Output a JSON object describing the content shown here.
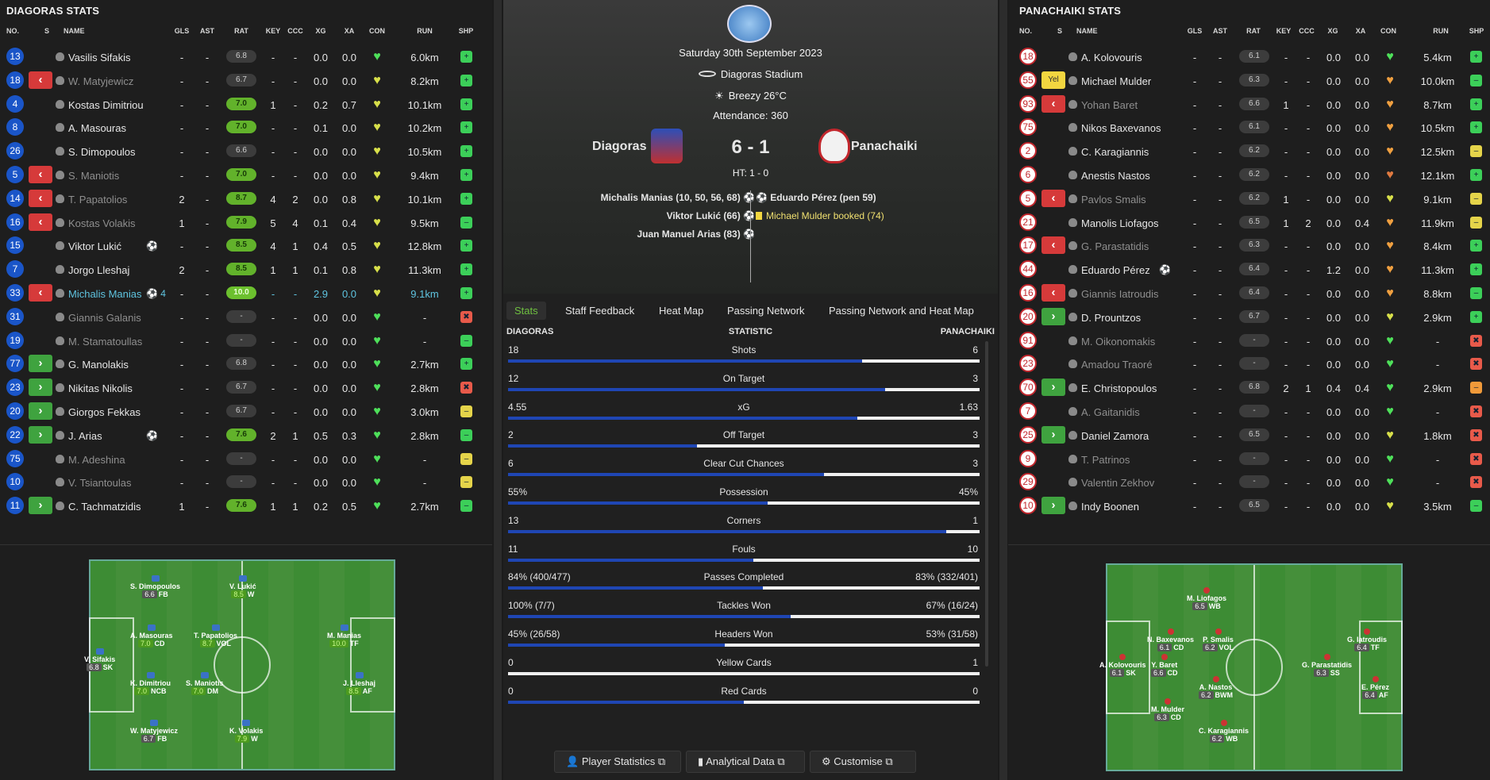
{
  "left": {
    "title": "DIAGORAS STATS",
    "headers": {
      "no": "NO.",
      "s": "S",
      "name": "NAME",
      "gls": "GLS",
      "ast": "AST",
      "rat": "RAT",
      "key": "KEY",
      "ccc": "CCC",
      "xg": "XG",
      "xa": "XA",
      "con": "CON",
      "run": "RUN",
      "shp": "SHP"
    },
    "players": [
      {
        "no": "13",
        "sub": "",
        "name": "Vasilis Sifakis",
        "style": "",
        "gls": "-",
        "ast": "-",
        "rat": "6.8",
        "rc": "",
        "key": "-",
        "ccc": "-",
        "xg": "0.0",
        "xa": "0.0",
        "con": "#4ee05a",
        "run": "6.0km",
        "shp": "g"
      },
      {
        "no": "18",
        "sub": "off",
        "name": "W. Matyjewicz",
        "style": "dim",
        "gls": "-",
        "ast": "-",
        "rat": "6.7",
        "rc": "",
        "key": "-",
        "ccc": "-",
        "xg": "0.0",
        "xa": "0.0",
        "con": "#d8e04a",
        "run": "8.2km",
        "shp": "g"
      },
      {
        "no": "4",
        "sub": "",
        "name": "Kostas Dimitriou",
        "style": "",
        "gls": "-",
        "ast": "-",
        "rat": "7.0",
        "rc": "g",
        "key": "1",
        "ccc": "-",
        "xg": "0.2",
        "xa": "0.7",
        "con": "#d8e04a",
        "run": "10.1km",
        "shp": "g"
      },
      {
        "no": "8",
        "sub": "",
        "name": "A. Masouras",
        "style": "",
        "gls": "-",
        "ast": "-",
        "rat": "7.0",
        "rc": "g",
        "key": "-",
        "ccc": "-",
        "xg": "0.1",
        "xa": "0.0",
        "con": "#d8e04a",
        "run": "10.2km",
        "shp": "g"
      },
      {
        "no": "26",
        "sub": "",
        "name": "S. Dimopoulos",
        "style": "",
        "gls": "-",
        "ast": "-",
        "rat": "6.6",
        "rc": "",
        "key": "-",
        "ccc": "-",
        "xg": "0.0",
        "xa": "0.0",
        "con": "#d8e04a",
        "run": "10.5km",
        "shp": "g"
      },
      {
        "no": "5",
        "sub": "off",
        "name": "S. Maniotis",
        "style": "dim",
        "gls": "-",
        "ast": "-",
        "rat": "7.0",
        "rc": "g",
        "key": "-",
        "ccc": "-",
        "xg": "0.0",
        "xa": "0.0",
        "con": "#d8e04a",
        "run": "9.4km",
        "shp": "g"
      },
      {
        "no": "14",
        "sub": "off",
        "name": "T. Papatolios",
        "style": "dim",
        "gls": "2",
        "ast": "-",
        "rat": "8.7",
        "rc": "g",
        "key": "4",
        "ccc": "2",
        "xg": "0.0",
        "xa": "0.8",
        "con": "#d8e04a",
        "run": "10.1km",
        "shp": "g"
      },
      {
        "no": "16",
        "sub": "off",
        "name": "Kostas Volakis",
        "style": "dim",
        "gls": "1",
        "ast": "-",
        "rat": "7.9",
        "rc": "g",
        "key": "5",
        "ccc": "4",
        "xg": "0.1",
        "xa": "0.4",
        "con": "#d8e04a",
        "run": "9.5km",
        "shp": "g2"
      },
      {
        "no": "15",
        "sub": "",
        "name": "Viktor Lukić",
        "style": "",
        "gls": "-",
        "ast": "-",
        "rat": "8.5",
        "rc": "g",
        "key": "4",
        "ccc": "1",
        "xg": "0.4",
        "xa": "0.5",
        "con": "#d8e04a",
        "run": "12.8km",
        "shp": "g",
        "ball": "1"
      },
      {
        "no": "7",
        "sub": "",
        "name": "Jorgo Lleshaj",
        "style": "",
        "gls": "2",
        "ast": "-",
        "rat": "8.5",
        "rc": "g",
        "key": "1",
        "ccc": "1",
        "xg": "0.1",
        "xa": "0.8",
        "con": "#d8e04a",
        "run": "11.3km",
        "shp": "g"
      },
      {
        "no": "33",
        "sub": "off",
        "name": "Michalis Manias",
        "style": "hl",
        "gls": "-",
        "ast": "-",
        "rat": "10.0",
        "rc": "hi",
        "key": "-",
        "ccc": "-",
        "xg": "2.9",
        "xa": "0.0",
        "con": "#d8e04a",
        "run": "9.1km",
        "shp": "g",
        "ball": "4"
      },
      {
        "no": "31",
        "sub": "",
        "name": "Giannis Galanis",
        "style": "dim",
        "gls": "-",
        "ast": "-",
        "rat": "-",
        "rc": "",
        "key": "-",
        "ccc": "-",
        "xg": "0.0",
        "xa": "0.0",
        "con": "#4ee05a",
        "run": "-",
        "shp": "r"
      },
      {
        "no": "19",
        "sub": "",
        "name": "M. Stamatoullas",
        "style": "dim",
        "gls": "-",
        "ast": "-",
        "rat": "-",
        "rc": "",
        "key": "-",
        "ccc": "-",
        "xg": "0.0",
        "xa": "0.0",
        "con": "#4ee05a",
        "run": "-",
        "shp": "g2"
      },
      {
        "no": "77",
        "sub": "on",
        "name": "G. Manolakis",
        "style": "",
        "gls": "-",
        "ast": "-",
        "rat": "6.8",
        "rc": "",
        "key": "-",
        "ccc": "-",
        "xg": "0.0",
        "xa": "0.0",
        "con": "#4ee05a",
        "run": "2.7km",
        "shp": "g"
      },
      {
        "no": "23",
        "sub": "on",
        "name": "Nikitas Nikolis",
        "style": "",
        "gls": "-",
        "ast": "-",
        "rat": "6.7",
        "rc": "",
        "key": "-",
        "ccc": "-",
        "xg": "0.0",
        "xa": "0.0",
        "con": "#4ee05a",
        "run": "2.8km",
        "shp": "r"
      },
      {
        "no": "20",
        "sub": "on",
        "name": "Giorgos Fekkas",
        "style": "",
        "gls": "-",
        "ast": "-",
        "rat": "6.7",
        "rc": "",
        "key": "-",
        "ccc": "-",
        "xg": "0.0",
        "xa": "0.0",
        "con": "#4ee05a",
        "run": "3.0km",
        "shp": "y"
      },
      {
        "no": "22",
        "sub": "on",
        "name": "J. Arias",
        "style": "",
        "gls": "-",
        "ast": "-",
        "rat": "7.6",
        "rc": "g",
        "key": "2",
        "ccc": "1",
        "xg": "0.5",
        "xa": "0.3",
        "con": "#4ee05a",
        "run": "2.8km",
        "shp": "g2",
        "ball": "1"
      },
      {
        "no": "75",
        "sub": "",
        "name": "M. Adeshina",
        "style": "dim",
        "gls": "-",
        "ast": "-",
        "rat": "-",
        "rc": "",
        "key": "-",
        "ccc": "-",
        "xg": "0.0",
        "xa": "0.0",
        "con": "#4ee05a",
        "run": "-",
        "shp": "y"
      },
      {
        "no": "10",
        "sub": "",
        "name": "V. Tsiantoulas",
        "style": "dim",
        "gls": "-",
        "ast": "-",
        "rat": "-",
        "rc": "",
        "key": "-",
        "ccc": "-",
        "xg": "0.0",
        "xa": "0.0",
        "con": "#4ee05a",
        "run": "-",
        "shp": "y"
      },
      {
        "no": "11",
        "sub": "on",
        "name": "C. Tachmatzidis",
        "style": "",
        "gls": "1",
        "ast": "-",
        "rat": "7.6",
        "rc": "g",
        "key": "1",
        "ccc": "1",
        "xg": "0.2",
        "xa": "0.5",
        "con": "#4ee05a",
        "run": "2.7km",
        "shp": "g2"
      }
    ],
    "pitch": [
      {
        "num": "26",
        "name": "S. Dimopoulos",
        "rat": "6.6",
        "rg": "",
        "pos": "FB"
      },
      {
        "num": "15",
        "name": "V. Lukić",
        "rat": "8.5",
        "rg": "g",
        "pos": "W"
      },
      {
        "num": "8",
        "name": "A. Masouras",
        "rat": "7.0",
        "rg": "g",
        "pos": "CD"
      },
      {
        "num": "14",
        "name": "T. Papatolios",
        "rat": "8.7",
        "rg": "g",
        "pos": "VOL"
      },
      {
        "num": "33",
        "name": "M. Manias",
        "rat": "10.0",
        "rg": "g",
        "pos": "TF"
      },
      {
        "num": "13",
        "name": "V. Sifakis",
        "rat": "6.8",
        "rg": "",
        "pos": "SK"
      },
      {
        "num": "4",
        "name": "K. Dimitriou",
        "rat": "7.0",
        "rg": "g",
        "pos": "NCB"
      },
      {
        "num": "5",
        "name": "S. Maniotis",
        "rat": "7.0",
        "rg": "g",
        "pos": "DM"
      },
      {
        "num": "7",
        "name": "J. Lleshaj",
        "rat": "8.5",
        "rg": "g",
        "pos": "AF"
      },
      {
        "num": "18",
        "name": "W. Matyjewicz",
        "rat": "6.7",
        "rg": "",
        "pos": "FB"
      },
      {
        "num": "16",
        "name": "K. Volakis",
        "rat": "7.9",
        "rg": "g",
        "pos": "W"
      }
    ]
  },
  "right": {
    "title": "PANACHAIKI STATS",
    "players": [
      {
        "no": "18",
        "sub": "",
        "name": "A. Kolovouris",
        "style": "",
        "gls": "-",
        "ast": "-",
        "rat": "6.1",
        "rc": "",
        "key": "-",
        "ccc": "-",
        "xg": "0.0",
        "xa": "0.0",
        "con": "#4ee05a",
        "run": "5.4km",
        "shp": "g"
      },
      {
        "no": "55",
        "sub": "yel",
        "name": "Michael Mulder",
        "style": "",
        "gls": "-",
        "ast": "-",
        "rat": "6.3",
        "rc": "",
        "key": "-",
        "ccc": "-",
        "xg": "0.0",
        "xa": "0.0",
        "con": "#f0a040",
        "run": "10.0km",
        "shp": "g2"
      },
      {
        "no": "93",
        "sub": "off",
        "name": "Yohan Baret",
        "style": "dim",
        "gls": "-",
        "ast": "-",
        "rat": "6.6",
        "rc": "",
        "key": "1",
        "ccc": "-",
        "xg": "0.0",
        "xa": "0.0",
        "con": "#f0a040",
        "run": "8.7km",
        "shp": "g"
      },
      {
        "no": "75",
        "sub": "",
        "name": "Nikos Baxevanos",
        "style": "",
        "gls": "-",
        "ast": "-",
        "rat": "6.1",
        "rc": "",
        "key": "-",
        "ccc": "-",
        "xg": "0.0",
        "xa": "0.0",
        "con": "#f0a040",
        "run": "10.5km",
        "shp": "g"
      },
      {
        "no": "2",
        "sub": "",
        "name": "C. Karagiannis",
        "style": "",
        "gls": "-",
        "ast": "-",
        "rat": "6.2",
        "rc": "",
        "key": "-",
        "ccc": "-",
        "xg": "0.0",
        "xa": "0.0",
        "con": "#f0a040",
        "run": "12.5km",
        "shp": "y"
      },
      {
        "no": "6",
        "sub": "",
        "name": "Anestis Nastos",
        "style": "",
        "gls": "-",
        "ast": "-",
        "rat": "6.2",
        "rc": "",
        "key": "-",
        "ccc": "-",
        "xg": "0.0",
        "xa": "0.0",
        "con": "#e07a40",
        "run": "12.1km",
        "shp": "g"
      },
      {
        "no": "5",
        "sub": "off",
        "name": "Pavlos Smalis",
        "style": "dim",
        "gls": "-",
        "ast": "-",
        "rat": "6.2",
        "rc": "",
        "key": "1",
        "ccc": "-",
        "xg": "0.0",
        "xa": "0.0",
        "con": "#d8e04a",
        "run": "9.1km",
        "shp": "y"
      },
      {
        "no": "21",
        "sub": "",
        "name": "Manolis Liofagos",
        "style": "",
        "gls": "-",
        "ast": "-",
        "rat": "6.5",
        "rc": "",
        "key": "1",
        "ccc": "2",
        "xg": "0.0",
        "xa": "0.4",
        "con": "#f0a040",
        "run": "11.9km",
        "shp": "y"
      },
      {
        "no": "17",
        "sub": "off",
        "name": "G. Parastatidis",
        "style": "dim",
        "gls": "-",
        "ast": "-",
        "rat": "6.3",
        "rc": "",
        "key": "-",
        "ccc": "-",
        "xg": "0.0",
        "xa": "0.0",
        "con": "#f0a040",
        "run": "8.4km",
        "shp": "g"
      },
      {
        "no": "44",
        "sub": "",
        "name": "Eduardo Pérez",
        "style": "",
        "gls": "-",
        "ast": "-",
        "rat": "6.4",
        "rc": "",
        "key": "-",
        "ccc": "-",
        "xg": "1.2",
        "xa": "0.0",
        "con": "#f0a040",
        "run": "11.3km",
        "shp": "g",
        "ball": "1"
      },
      {
        "no": "16",
        "sub": "off",
        "name": "Giannis Iatroudis",
        "style": "dim",
        "gls": "-",
        "ast": "-",
        "rat": "6.4",
        "rc": "",
        "key": "-",
        "ccc": "-",
        "xg": "0.0",
        "xa": "0.0",
        "con": "#f0a040",
        "run": "8.8km",
        "shp": "g2"
      },
      {
        "no": "20",
        "sub": "on",
        "name": "D. Prountzos",
        "style": "",
        "gls": "-",
        "ast": "-",
        "rat": "6.7",
        "rc": "",
        "key": "-",
        "ccc": "-",
        "xg": "0.0",
        "xa": "0.0",
        "con": "#d8e04a",
        "run": "2.9km",
        "shp": "g"
      },
      {
        "no": "91",
        "sub": "",
        "name": "M. Oikonomakis",
        "style": "dim",
        "gls": "-",
        "ast": "-",
        "rat": "-",
        "rc": "",
        "key": "-",
        "ccc": "-",
        "xg": "0.0",
        "xa": "0.0",
        "con": "#4ee05a",
        "run": "-",
        "shp": "r"
      },
      {
        "no": "23",
        "sub": "",
        "name": "Amadou Traoré",
        "style": "dim",
        "gls": "-",
        "ast": "-",
        "rat": "-",
        "rc": "",
        "key": "-",
        "ccc": "-",
        "xg": "0.0",
        "xa": "0.0",
        "con": "#4ee05a",
        "run": "-",
        "shp": "r"
      },
      {
        "no": "70",
        "sub": "on",
        "name": "E. Christopoulos",
        "style": "",
        "gls": "-",
        "ast": "-",
        "rat": "6.8",
        "rc": "",
        "key": "2",
        "ccc": "1",
        "xg": "0.4",
        "xa": "0.4",
        "con": "#4ee05a",
        "run": "2.9km",
        "shp": "o"
      },
      {
        "no": "7",
        "sub": "",
        "name": "A. Gaitanidis",
        "style": "dim",
        "gls": "-",
        "ast": "-",
        "rat": "-",
        "rc": "",
        "key": "-",
        "ccc": "-",
        "xg": "0.0",
        "xa": "0.0",
        "con": "#4ee05a",
        "run": "-",
        "shp": "r"
      },
      {
        "no": "25",
        "sub": "on",
        "name": "Daniel Zamora",
        "style": "",
        "gls": "-",
        "ast": "-",
        "rat": "6.5",
        "rc": "",
        "key": "-",
        "ccc": "-",
        "xg": "0.0",
        "xa": "0.0",
        "con": "#d8e04a",
        "run": "1.8km",
        "shp": "r"
      },
      {
        "no": "9",
        "sub": "",
        "name": "T. Patrinos",
        "style": "dim",
        "gls": "-",
        "ast": "-",
        "rat": "-",
        "rc": "",
        "key": "-",
        "ccc": "-",
        "xg": "0.0",
        "xa": "0.0",
        "con": "#4ee05a",
        "run": "-",
        "shp": "r"
      },
      {
        "no": "29",
        "sub": "",
        "name": "Valentin Zekhov",
        "style": "dim",
        "gls": "-",
        "ast": "-",
        "rat": "-",
        "rc": "",
        "key": "-",
        "ccc": "-",
        "xg": "0.0",
        "xa": "0.0",
        "con": "#4ee05a",
        "run": "-",
        "shp": "r"
      },
      {
        "no": "10",
        "sub": "on",
        "name": "Indy Boonen",
        "style": "",
        "gls": "-",
        "ast": "-",
        "rat": "6.5",
        "rc": "",
        "key": "-",
        "ccc": "-",
        "xg": "0.0",
        "xa": "0.0",
        "con": "#d8e04a",
        "run": "3.5km",
        "shp": "g2"
      }
    ],
    "pitch": [
      {
        "num": "21",
        "name": "M. Liofagos",
        "rat": "6.5",
        "pos": "WB"
      },
      {
        "num": "75",
        "name": "N. Baxevanos",
        "rat": "6.1",
        "pos": "CD"
      },
      {
        "num": "5",
        "name": "P. Smalis",
        "rat": "6.2",
        "pos": "VOL"
      },
      {
        "num": "16",
        "name": "G. Iatroudis",
        "rat": "6.4",
        "pos": "TF"
      },
      {
        "num": "18",
        "name": "A. Kolovouris",
        "rat": "6.1",
        "pos": "SK"
      },
      {
        "num": "93",
        "name": "Y. Baret",
        "rat": "6.6",
        "pos": "CD"
      },
      {
        "num": "17",
        "name": "G. Parastatidis",
        "rat": "6.3",
        "pos": "SS"
      },
      {
        "num": "6",
        "name": "A. Nastos",
        "rat": "6.2",
        "pos": "BWM"
      },
      {
        "num": "44",
        "name": "E. Pérez",
        "rat": "6.4",
        "pos": "AF"
      },
      {
        "num": "55",
        "name": "M. Mulder",
        "rat": "6.3",
        "pos": "CD"
      },
      {
        "num": "2",
        "name": "C. Karagiannis",
        "rat": "6.2",
        "pos": "WB"
      }
    ]
  },
  "match": {
    "date": "Saturday 30th September 2023",
    "stadium": "Diagoras Stadium",
    "weather": "Breezy 26°C",
    "attendance": "Attendance: 360",
    "home": "Diagoras",
    "away": "Panachaiki",
    "score": "6 - 1",
    "ht": "HT: 1 - 0",
    "home_events": [
      "Michalis Manias (10, 50, 56, 68)",
      "Viktor Lukić (66)",
      "Juan Manuel Arias (83)"
    ],
    "away_goal": "Eduardo Pérez (pen 59)",
    "away_booking": "Michael Mulder booked (74)"
  },
  "tabs": [
    "Stats",
    "Staff Feedback",
    "Heat Map",
    "Passing Network",
    "Passing Network and Heat Map"
  ],
  "stats_header": {
    "home": "DIAGORAS",
    "mid": "STATISTIC",
    "away": "PANACHAIKI"
  },
  "stats": [
    {
      "home": "18",
      "label": "Shots",
      "away": "6",
      "frac": 0.75
    },
    {
      "home": "12",
      "label": "On Target",
      "away": "3",
      "frac": 0.8
    },
    {
      "home": "4.55",
      "label": "xG",
      "away": "1.63",
      "frac": 0.74
    },
    {
      "home": "2",
      "label": "Off Target",
      "away": "3",
      "frac": 0.4
    },
    {
      "home": "6",
      "label": "Clear Cut Chances",
      "away": "3",
      "frac": 0.67
    },
    {
      "home": "55%",
      "label": "Possession",
      "away": "45%",
      "frac": 0.55
    },
    {
      "home": "13",
      "label": "Corners",
      "away": "1",
      "frac": 0.93
    },
    {
      "home": "11",
      "label": "Fouls",
      "away": "10",
      "frac": 0.52
    },
    {
      "home": "84% (400/477)",
      "label": "Passes Completed",
      "away": "83% (332/401)",
      "frac": 0.54
    },
    {
      "home": "100% (7/7)",
      "label": "Tackles Won",
      "away": "67% (16/24)",
      "frac": 0.6
    },
    {
      "home": "45% (26/58)",
      "label": "Headers Won",
      "away": "53% (31/58)",
      "frac": 0.46
    },
    {
      "home": "0",
      "label": "Yellow Cards",
      "away": "1",
      "frac": 0
    },
    {
      "home": "0",
      "label": "Red Cards",
      "away": "0",
      "frac": 0.5
    }
  ],
  "buttons": {
    "player_stats": "Player Statistics",
    "analytical": "Analytical Data",
    "customise": "Customise"
  },
  "colors": {
    "home": "#1a55c8",
    "away": "#c2272d",
    "accent": "#6fc040"
  }
}
